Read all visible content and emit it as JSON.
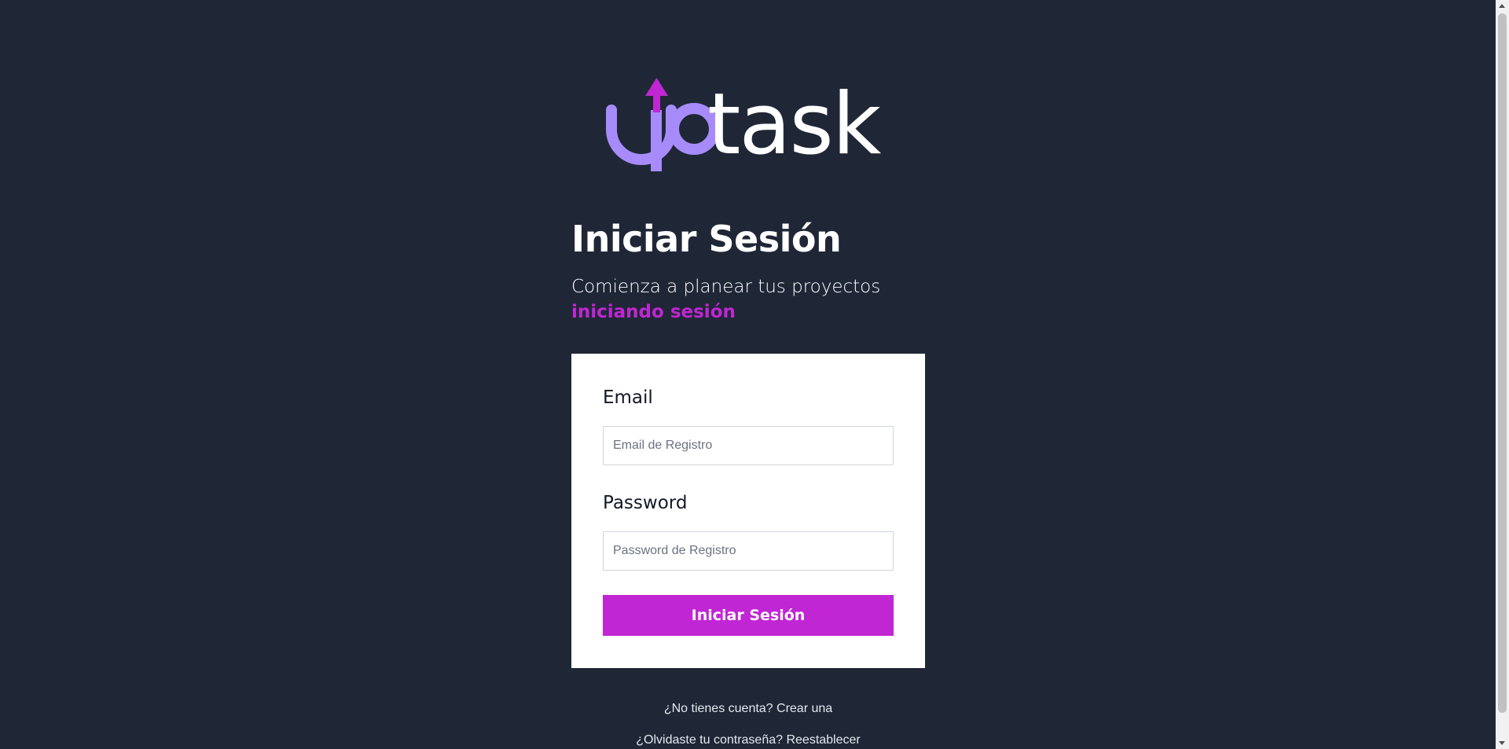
{
  "logo": {
    "text": "uptask",
    "brand_color": "#a78bfa",
    "arrow_color": "#c026d3"
  },
  "header": {
    "title": "Iniciar Sesión",
    "subtitle": "Comienza a planear tus proyectos",
    "subtitle_accent": "iniciando sesión"
  },
  "form": {
    "email_label": "Email",
    "email_placeholder": "Email de Registro",
    "password_label": "Password",
    "password_placeholder": "Password de Registro",
    "submit_label": "Iniciar Sesión"
  },
  "links": {
    "register": "¿No tienes cuenta? Crear una",
    "forgot": "¿Olvidaste tu contraseña? Reestablecer"
  },
  "colors": {
    "background": "#1f2737",
    "accent": "#c026d3",
    "card": "#ffffff"
  }
}
